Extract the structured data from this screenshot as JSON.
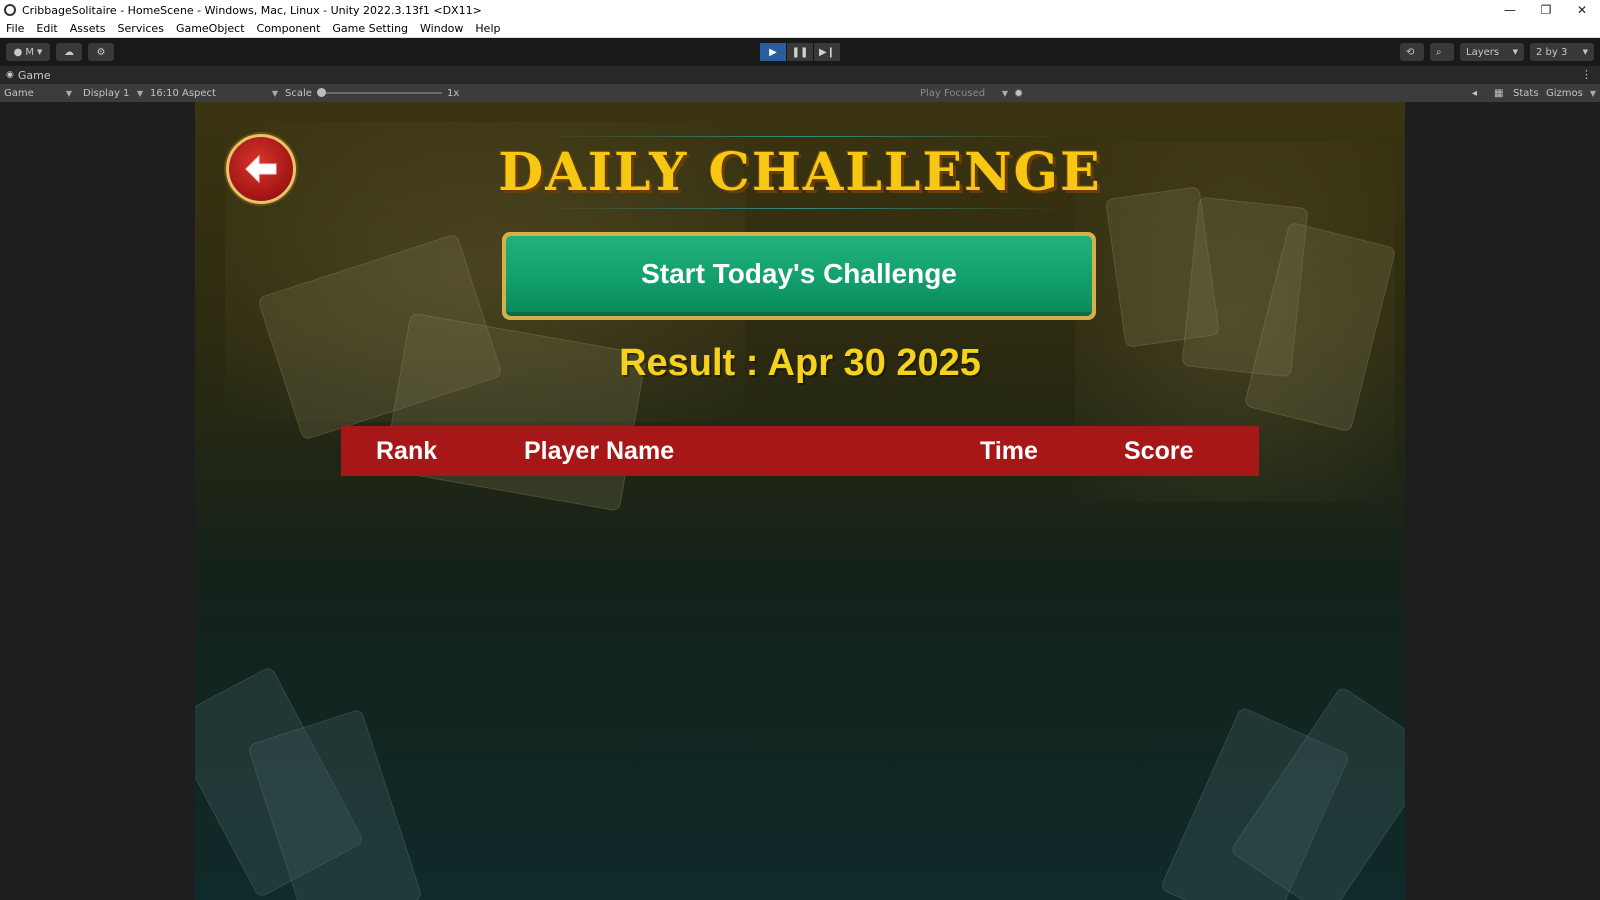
{
  "window": {
    "title": "CribbageSolitaire - HomeScene - Windows, Mac, Linux - Unity 2022.3.13f1 <DX11>",
    "controls": {
      "minimize": "—",
      "restore": "❐",
      "close": "✕"
    }
  },
  "menu": [
    "File",
    "Edit",
    "Assets",
    "Services",
    "GameObject",
    "Component",
    "Game Setting",
    "Window",
    "Help"
  ],
  "toolbar": {
    "account": "M",
    "layers": "Layers",
    "layout": "2 by 3"
  },
  "tab": {
    "label": "Game"
  },
  "game_toolbar": {
    "mode": "Game",
    "display": "Display 1",
    "aspect": "16:10 Aspect",
    "scale_label": "Scale",
    "scale_value": "1x",
    "play_mode": "Play Focused",
    "stats": "Stats",
    "gizmos": "Gizmos"
  },
  "game": {
    "title": "DAILY CHALLENGE",
    "start_button": "Start Today's Challenge",
    "result": "Result : Apr 30 2025",
    "columns": {
      "rank": "Rank",
      "player": "Player Name",
      "time": "Time",
      "score": "Score"
    }
  },
  "colors": {
    "accent_play": "#2a5d9e",
    "title_gold": "#f6c814",
    "button_green": "#12a06d",
    "header_red": "#a81717"
  }
}
